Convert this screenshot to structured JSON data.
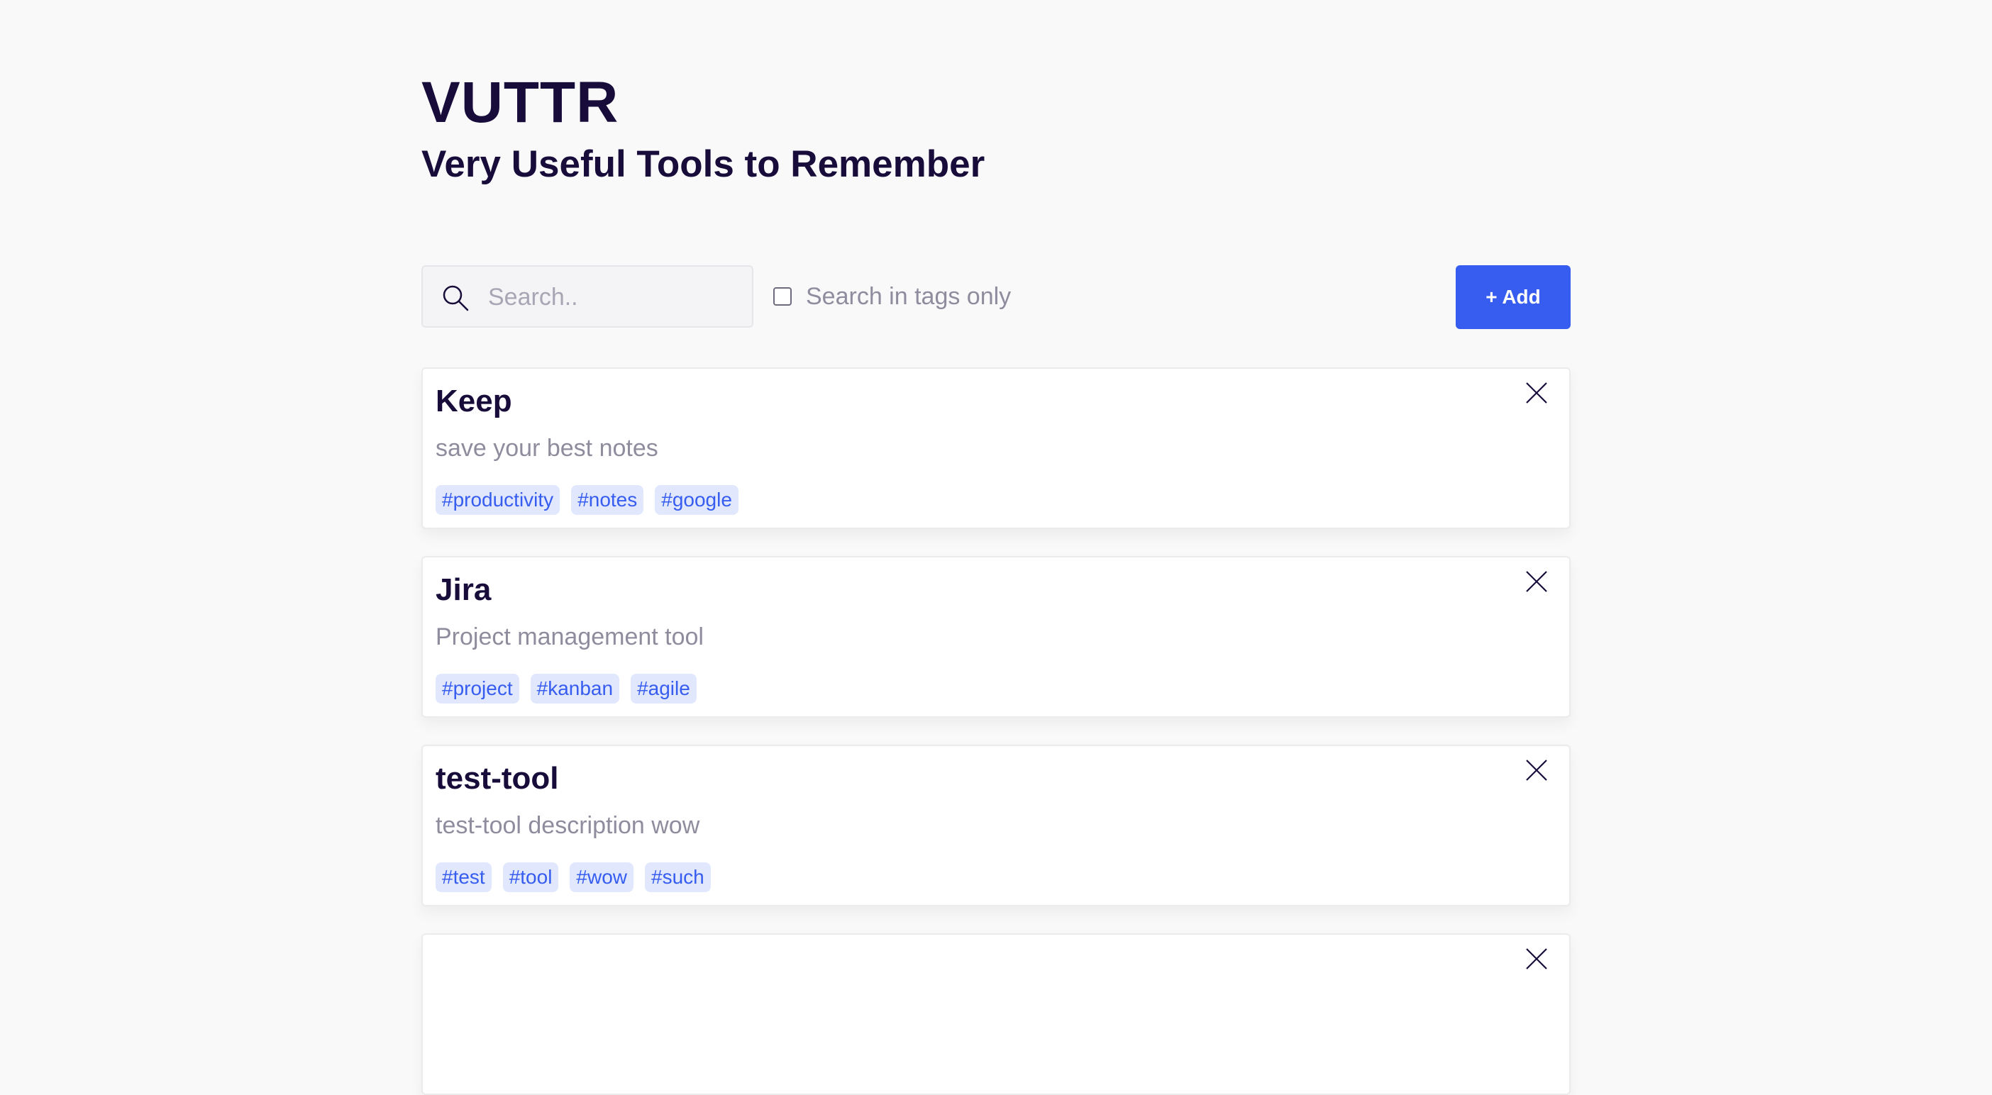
{
  "header": {
    "title": "VUTTR",
    "subtitle": "Very Useful Tools to Remember"
  },
  "search": {
    "icon": "search-icon",
    "placeholder": "Search..",
    "value": "",
    "tags_only_label": "Search in tags only",
    "tags_only_checked": false
  },
  "add_button": {
    "label": "+ Add",
    "color": "#365df0"
  },
  "tools": [
    {
      "name": "Keep",
      "description": "save your best notes",
      "tags": [
        "#productivity",
        "#notes",
        "#google"
      ]
    },
    {
      "name": "Jira",
      "description": "Project management tool",
      "tags": [
        "#project",
        "#kanban",
        "#agile"
      ]
    },
    {
      "name": "test-tool",
      "description": "test-tool description wow",
      "tags": [
        "#test",
        "#tool",
        "#wow",
        "#such"
      ]
    },
    {
      "name": "",
      "description": "",
      "tags": []
    }
  ],
  "colors": {
    "background": "#f9f9fa",
    "heading": "#170c3a",
    "muted_text": "#8f8c9e",
    "tag_background": "#e1e7fd",
    "tag_text": "#365df0"
  }
}
